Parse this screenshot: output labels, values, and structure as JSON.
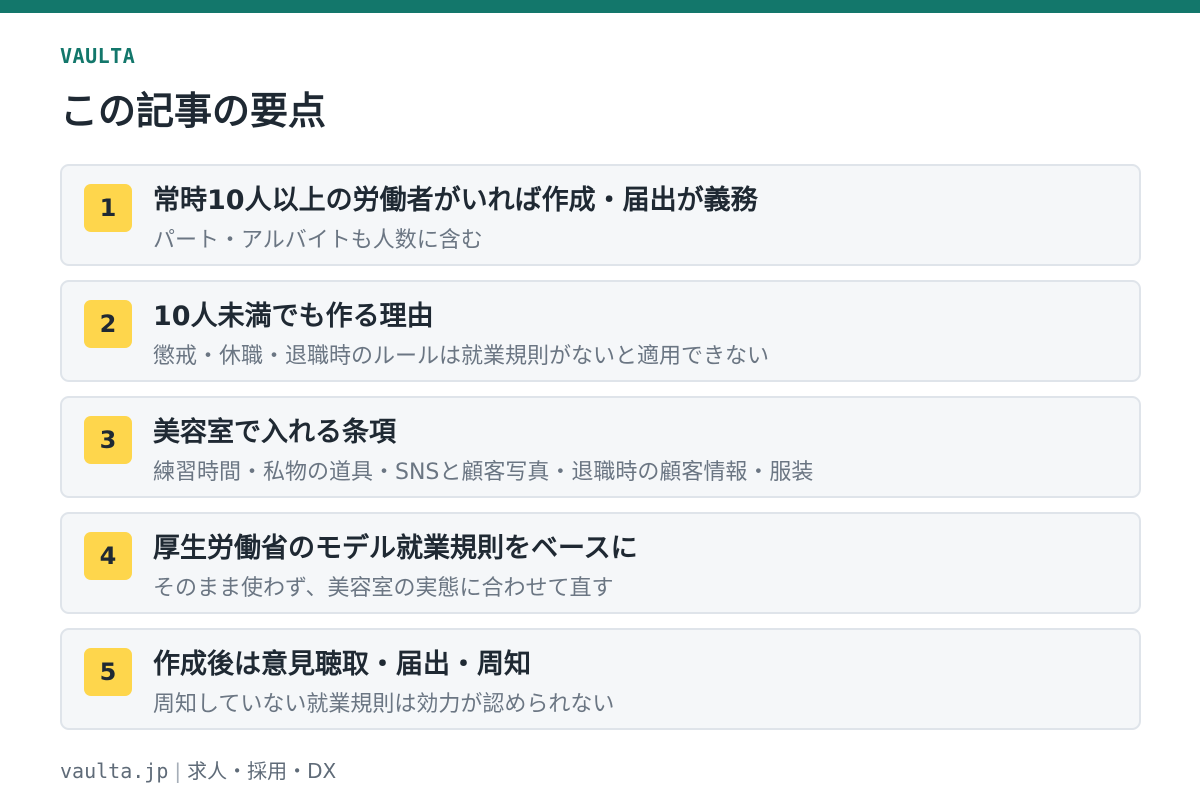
{
  "brand": {
    "name": "VAULTA",
    "color": "#13776b"
  },
  "title": "この記事の要点",
  "points": [
    {
      "number": "1",
      "title": "常時10人以上の労働者がいれば作成・届出が義務",
      "subtitle": "パート・アルバイトも人数に含む"
    },
    {
      "number": "2",
      "title": "10人未満でも作る理由",
      "subtitle": "懲戒・休職・退職時のルールは就業規則がないと適用できない"
    },
    {
      "number": "3",
      "title": "美容室で入れる条項",
      "subtitle": "練習時間・私物の道具・SNSと顧客写真・退職時の顧客情報・服装"
    },
    {
      "number": "4",
      "title": "厚生労働省のモデル就業規則をベースに",
      "subtitle": "そのまま使わず、美容室の実態に合わせて直す"
    },
    {
      "number": "5",
      "title": "作成後は意見聴取・届出・周知",
      "subtitle": "周知していない就業規則は効力が認められない"
    }
  ],
  "footer": {
    "domain": "vaulta.jp",
    "separator": "|",
    "tagline": "求人・採用・DX"
  },
  "colors": {
    "accent": "#13776b",
    "badge": "#fed64c",
    "card_background": "#f5f7f9",
    "card_border": "#dfe4ea"
  }
}
